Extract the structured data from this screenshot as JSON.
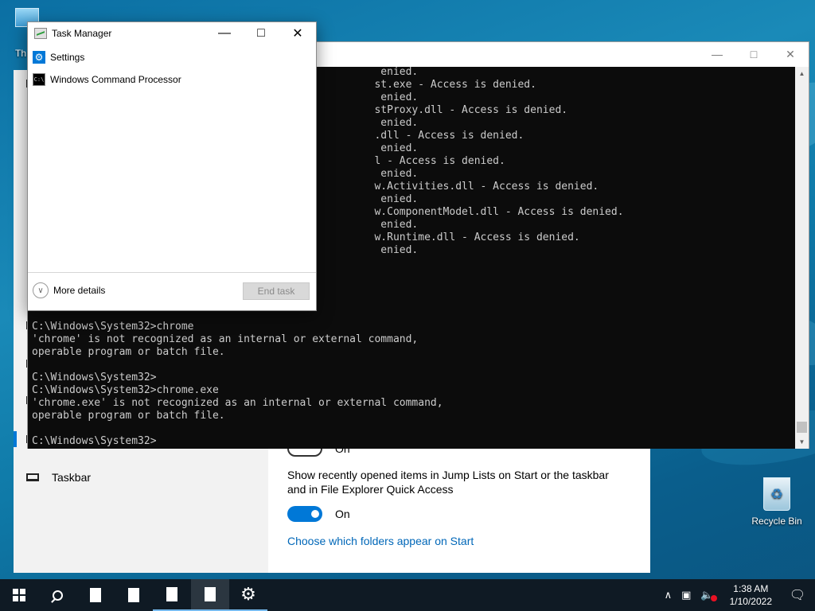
{
  "desktop": {
    "this_pc_label": "Th",
    "recycle_bin_label": "Recycle Bin"
  },
  "settings": {
    "sidebar_item_label": "Taskbar",
    "jump_list_text": "Show recently opened items in Jump Lists on Start or the taskbar and in File Explorer Quick Access",
    "toggle_top_state": "On",
    "toggle_state": "On",
    "folders_link": "Choose which folders appear on Start"
  },
  "cmd": {
    "lines": [
      "                                                        enied.",
      "                                                       st.exe - Access is denied.",
      "                                                        enied.",
      "                                                       stProxy.dll - Access is denied.",
      "                                                        enied.",
      "                                                       .dll - Access is denied.",
      "                                                        enied.",
      "                                                       l - Access is denied.",
      "                                                        enied.",
      "                                                       w.Activities.dll - Access is denied.",
      "                                                        enied.",
      "                                                       w.ComponentModel.dll - Access is denied.",
      "                                                        enied.",
      "                                                       w.Runtime.dll - Access is denied.",
      "                                                        enied.",
      "",
      "",
      "",
      "",
      "",
      "C:\\Windows\\System32>chrome",
      "'chrome' is not recognized as an internal or external command,",
      "operable program or batch file.",
      "",
      "C:\\Windows\\System32>",
      "C:\\Windows\\System32>chrome.exe",
      "'chrome.exe' is not recognized as an internal or external command,",
      "operable program or batch file.",
      "",
      "C:\\Windows\\System32>"
    ]
  },
  "task_manager": {
    "title": "Task Manager",
    "apps": [
      "Settings",
      "Windows Command Processor"
    ],
    "more_details": "More details",
    "end_task": "End task"
  },
  "taskbar": {
    "time": "1:38 AM",
    "date": "1/10/2022"
  }
}
